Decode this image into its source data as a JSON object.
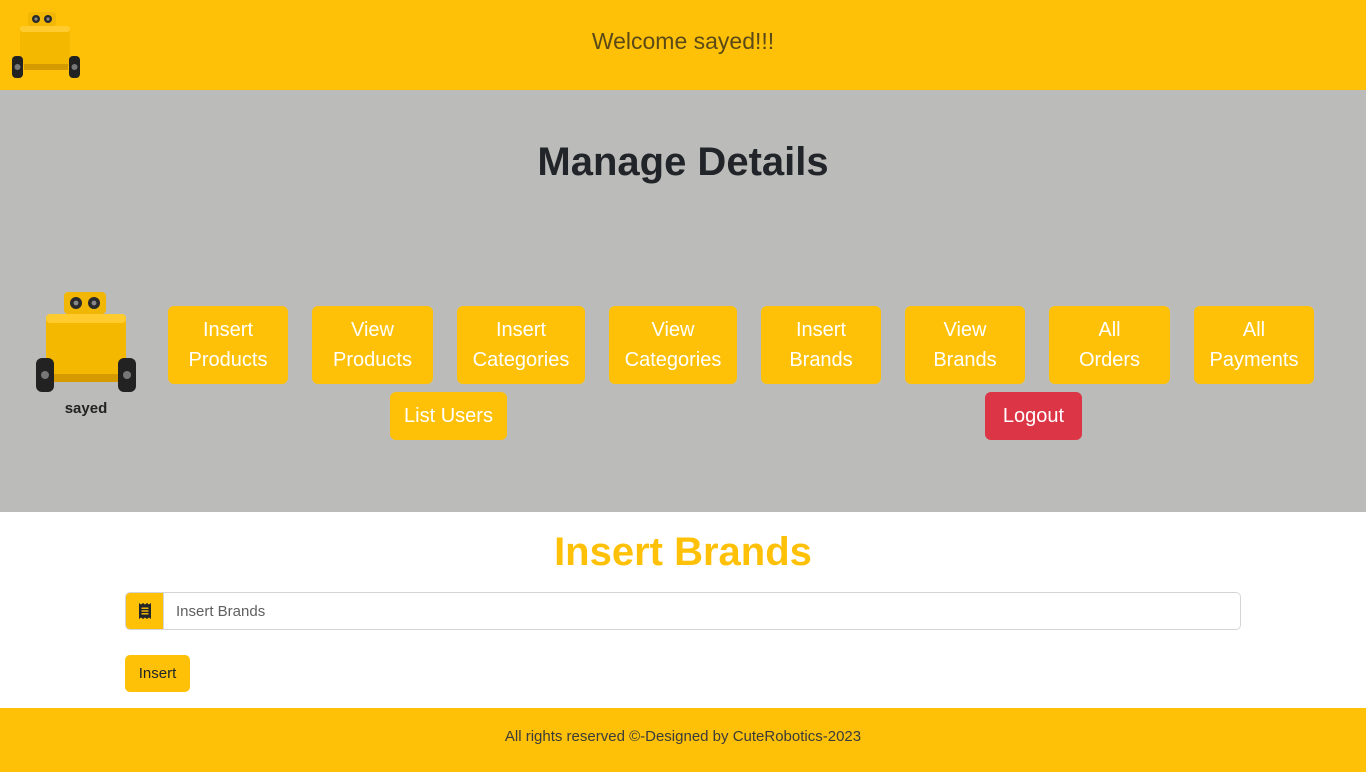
{
  "header": {
    "welcome_text": "Welcome sayed!!!",
    "logo_icon": "robot-icon"
  },
  "manage": {
    "title": "Manage Details",
    "profile_name": "sayed",
    "avatar_icon": "robot-icon",
    "buttons": [
      {
        "line1": "Insert",
        "line2": "Products"
      },
      {
        "line1": "View",
        "line2": "Products"
      },
      {
        "line1": "Insert",
        "line2": "Categories"
      },
      {
        "line1": "View",
        "line2": "Categories"
      },
      {
        "line1": "Insert",
        "line2": "Brands"
      },
      {
        "line1": "View",
        "line2": "Brands"
      },
      {
        "line1": "All",
        "line2": "Orders"
      },
      {
        "line1": "All",
        "line2": "Payments"
      }
    ],
    "list_users": "List Users",
    "logout": "Logout"
  },
  "form": {
    "title": "Insert Brands",
    "input_placeholder": "Insert Brands",
    "input_icon": "receipt-icon",
    "submit_label": "Insert"
  },
  "footer": {
    "text": "All rights reserved ©-Designed by CuteRobotics-2023"
  },
  "colors": {
    "primary": "#ffc107",
    "danger": "#dc3545",
    "manage_bg": "#bbbbb9"
  }
}
